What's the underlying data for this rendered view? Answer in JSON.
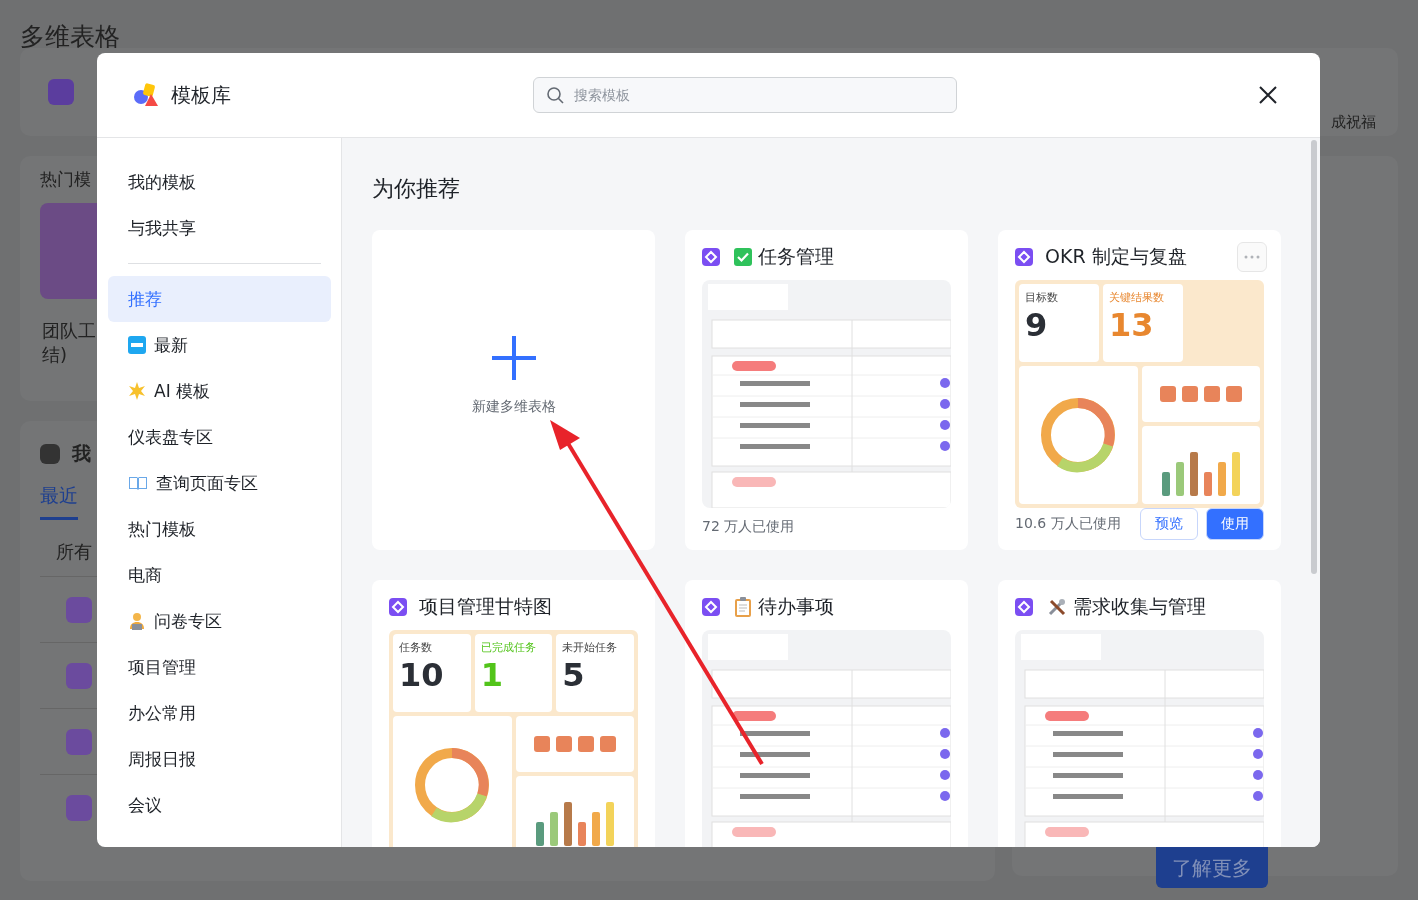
{
  "background": {
    "title": "多维表格",
    "top_card": {
      "text": "成祝福"
    },
    "hot": {
      "heading": "热门模",
      "item_lines": [
        "团队工",
        "结)"
      ]
    },
    "mine": {
      "heading": "我",
      "tabs": [
        {
          "label": "最近",
          "selected": true
        }
      ],
      "filter": "所有"
    },
    "promo": {
      "button": "了解更多"
    }
  },
  "dialog": {
    "title": "模板库",
    "search": {
      "placeholder": "搜索模板"
    },
    "sidebar": [
      [
        {
          "label": "我的模板",
          "kind": "plain",
          "selected": false
        },
        {
          "label": "与我共享",
          "kind": "plain",
          "selected": false
        }
      ],
      [
        {
          "label": "推荐",
          "kind": "plain",
          "selected": true
        },
        {
          "label": "最新",
          "kind": "new",
          "selected": false
        },
        {
          "label": "AI 模板",
          "kind": "sparkle",
          "selected": false
        },
        {
          "label": "仪表盘专区",
          "kind": "plain",
          "selected": false
        },
        {
          "label": "查询页面专区",
          "kind": "book",
          "selected": false
        },
        {
          "label": "热门模板",
          "kind": "plain",
          "selected": false
        },
        {
          "label": "电商",
          "kind": "plain",
          "selected": false
        },
        {
          "label": "问卷专区",
          "kind": "worker",
          "selected": false
        },
        {
          "label": "项目管理",
          "kind": "plain",
          "selected": false
        },
        {
          "label": "办公常用",
          "kind": "plain",
          "selected": false
        },
        {
          "label": "周报日报",
          "kind": "plain",
          "selected": false
        },
        {
          "label": "会议",
          "kind": "plain",
          "selected": false
        }
      ]
    ],
    "section_title": "为你推荐",
    "cards": [
      {
        "kind": "new",
        "label": "新建多维表格"
      },
      {
        "kind": "table",
        "title": {
          "text": "任务管理",
          "kind": "check"
        },
        "usage": "72 万人已使用",
        "hovered": false
      },
      {
        "kind": "dashboard",
        "title": {
          "text": "OKR 制定与复盘",
          "kind": "plain"
        },
        "stats": [
          {
            "label": "目标数",
            "value": "9",
            "color": "#2b2f36"
          },
          {
            "label": "关键结果数",
            "value": "13",
            "color": "#e8872f"
          }
        ],
        "usage": "10.6 万人已使用",
        "hovered": true,
        "actions": [
          "预览",
          "使用"
        ]
      },
      {
        "kind": "dashboard",
        "title": {
          "text": "项目管理甘特图",
          "kind": "plain"
        },
        "stats": [
          {
            "label": "任务数",
            "value": "10",
            "color": "#2b2f36"
          },
          {
            "label": "已完成任务",
            "value": "1",
            "color": "#52c41a"
          },
          {
            "label": "未开始任务",
            "value": "5",
            "color": "#2b2f36"
          }
        ],
        "hovered": false
      },
      {
        "kind": "table",
        "title": {
          "text": "待办事项",
          "kind": "clipboard"
        },
        "hovered": false
      },
      {
        "kind": "table",
        "title": {
          "text": "需求收集与管理",
          "kind": "tools"
        },
        "hovered": false
      }
    ]
  }
}
